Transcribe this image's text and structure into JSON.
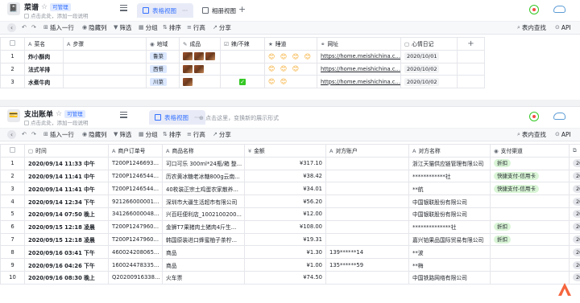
{
  "app": {
    "brand_color": "#3370ff",
    "accent_green": "#34c724"
  },
  "table1": {
    "title": "菜谱",
    "badge": "可管理",
    "subtitle": "点击此处，添加一段说明",
    "tabs": [
      {
        "label": "表格视图",
        "active": true
      },
      {
        "label": "相册视图",
        "active": false
      }
    ],
    "toolbar": {
      "insert": "插入一行",
      "hide": "隐藏列",
      "filter": "筛选",
      "group": "分组",
      "sort": "排序",
      "row_height": "行高",
      "share": "分享",
      "search": "表内查找",
      "api": "API"
    },
    "columns": [
      "菜名",
      "步骤",
      "地域",
      "成品",
      "辣/不辣",
      "睡道",
      "网址",
      "心情日记"
    ],
    "rows": [
      {
        "no": "1",
        "name": "炸小酥肉",
        "steps": "",
        "region": "鲁菜",
        "photo_count": 3,
        "spicy": false,
        "mood": "😊 😊 😊 😊",
        "url": "https://home.meishichina.c...",
        "date": "2020/10/01"
      },
      {
        "no": "2",
        "name": "法式羊排",
        "steps": "",
        "region": "西餐",
        "photo_count": 2,
        "spicy": false,
        "mood": "😊 😊 😊",
        "url": "https://home.meishichina.c...",
        "date": "2020/10/02"
      },
      {
        "no": "3",
        "name": "水煮牛肉",
        "steps": "",
        "region": "川菜",
        "photo_count": 1,
        "spicy": true,
        "mood": "😊 😊",
        "url": "https://home.meishichina.c...",
        "date": "2020/10/02"
      }
    ]
  },
  "table2": {
    "title": "支出账单",
    "badge": "可管理",
    "subtitle": "点击此处，添加一段说明",
    "tabs": [
      {
        "label": "表格视图",
        "active": true
      }
    ],
    "tab_hint": "点击这里，变换新的展示形式",
    "toolbar": {
      "insert": "插入一行",
      "hide": "隐藏列",
      "filter": "筛选",
      "group": "分组",
      "sort": "排序",
      "row_height": "行高",
      "share": "分享",
      "search": "表内查找",
      "api": "API"
    },
    "columns": [
      "时间",
      "商户订单号",
      "商品名称",
      "金额",
      "对方账户",
      "对方名称",
      "支付渠道"
    ],
    "rows": [
      {
        "no": "1",
        "time": "2020/09/14  11:33  中午",
        "order": "T200P1246693...",
        "item": "可口可乐 300ml*24瓶/箱 整...",
        "amount": "¥317.10",
        "account": "",
        "party": "浙江天猫供应链管理有限公司",
        "channel": "折扣"
      },
      {
        "no": "2",
        "time": "2020/09/14  11:41  中午",
        "order": "T200P1246544...",
        "item": "历农黄冰糖老冰糖800g云南...",
        "amount": "¥38.42",
        "account": "",
        "party": "************社",
        "channel": "快捷支付-信用卡"
      },
      {
        "no": "3",
        "time": "2020/09/14  11:41  中午",
        "order": "T200P1246544...",
        "item": "40枚装正宗土鸡蛋农家散养...",
        "amount": "¥34.01",
        "account": "",
        "party": "**航",
        "channel": "快捷支付-信用卡"
      },
      {
        "no": "4",
        "time": "2020/09/14  12:34  下午",
        "order": "921266000001...",
        "item": "深圳市大疆生活超市有限公司",
        "amount": "¥56.20",
        "account": "",
        "party": "中国银联股份有限公司",
        "channel": ""
      },
      {
        "no": "5",
        "time": "2020/09/14  07:50  晚上",
        "order": "341266000048...",
        "item": "兴百旺便利店_1002100200...",
        "amount": "¥12.00",
        "account": "",
        "party": "中国银联股份有限公司",
        "channel": ""
      },
      {
        "no": "6",
        "time": "2020/09/15  12:18  凌晨",
        "order": "T200P1247960...",
        "item": "金狮T7果猪肉土猪肉4斤生...",
        "amount": "¥108.00",
        "account": "",
        "party": "**************社",
        "channel": "折扣"
      },
      {
        "no": "7",
        "time": "2020/09/15  12:18  凌晨",
        "order": "T200P1247960...",
        "item": "韩国原装进口蜂蜜柚子茶柠...",
        "amount": "¥19.31",
        "account": "",
        "party": "嘉兴铂果品国际贸易有限公司",
        "channel": "折扣"
      },
      {
        "no": "8",
        "time": "2020/09/16  03:41  下午",
        "order": "460024208065...",
        "item": "商品",
        "amount": "¥1.30",
        "account": "139******14",
        "party": "**波",
        "channel": ""
      },
      {
        "no": "9",
        "time": "2020/09/16  04:26  下午",
        "order": "160024478335...",
        "item": "商品",
        "amount": "¥1.00",
        "account": "135******59",
        "party": "**梅",
        "channel": ""
      },
      {
        "no": "10",
        "time": "2020/09/16  08:30  晚上",
        "order": "Q20200916338...",
        "item": "火车票",
        "amount": "¥74.50",
        "account": "",
        "party": "中国铁路网络有限公司",
        "channel": ""
      }
    ]
  }
}
